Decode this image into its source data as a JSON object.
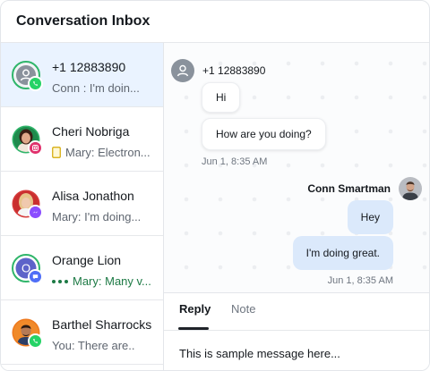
{
  "header": {
    "title": "Conversation Inbox"
  },
  "conversations": [
    {
      "name": "+1 12883890",
      "preview": "Conn : I'm doin...",
      "avatar": "default-user",
      "channel": "whatsapp"
    },
    {
      "name": "Cheri Nobriga",
      "preview": "Mary: Electron...",
      "avatar": "photo",
      "channel": "instagram",
      "preview_icon": "note-icon"
    },
    {
      "name": "Alisa Jonathon",
      "preview": "Mary: I'm doing...",
      "avatar": "photo",
      "channel": "messenger"
    },
    {
      "name": "Orange Lion",
      "preview": "Mary: Many v...",
      "avatar_initial": "O",
      "channel": "chat",
      "typing": true
    },
    {
      "name": "Barthel Sharrocks",
      "preview": "You: There are..",
      "avatar": "photo",
      "channel": "whatsapp"
    }
  ],
  "chat": {
    "contact_name": "+1 12883890",
    "incoming": [
      "Hi",
      "How are you doing?"
    ],
    "incoming_time": "Jun 1, 8:35 AM",
    "agent_name": "Conn Smartman",
    "outgoing": [
      "Hey",
      "I'm doing great."
    ],
    "outgoing_time": "Jun 1, 8:35 AM"
  },
  "composer": {
    "tabs": [
      "Reply",
      "Note"
    ],
    "active_tab": "Reply",
    "draft": "This is sample message here..."
  },
  "colors": {
    "active_row": "#eaf3ff",
    "outgoing_bubble": "#dbe9fb",
    "whatsapp": "#25d366",
    "instagram": "#e1306c",
    "messenger": "#8a4dff",
    "chat": "#4f6ef7",
    "avatar_ring": "#2fb56a"
  }
}
